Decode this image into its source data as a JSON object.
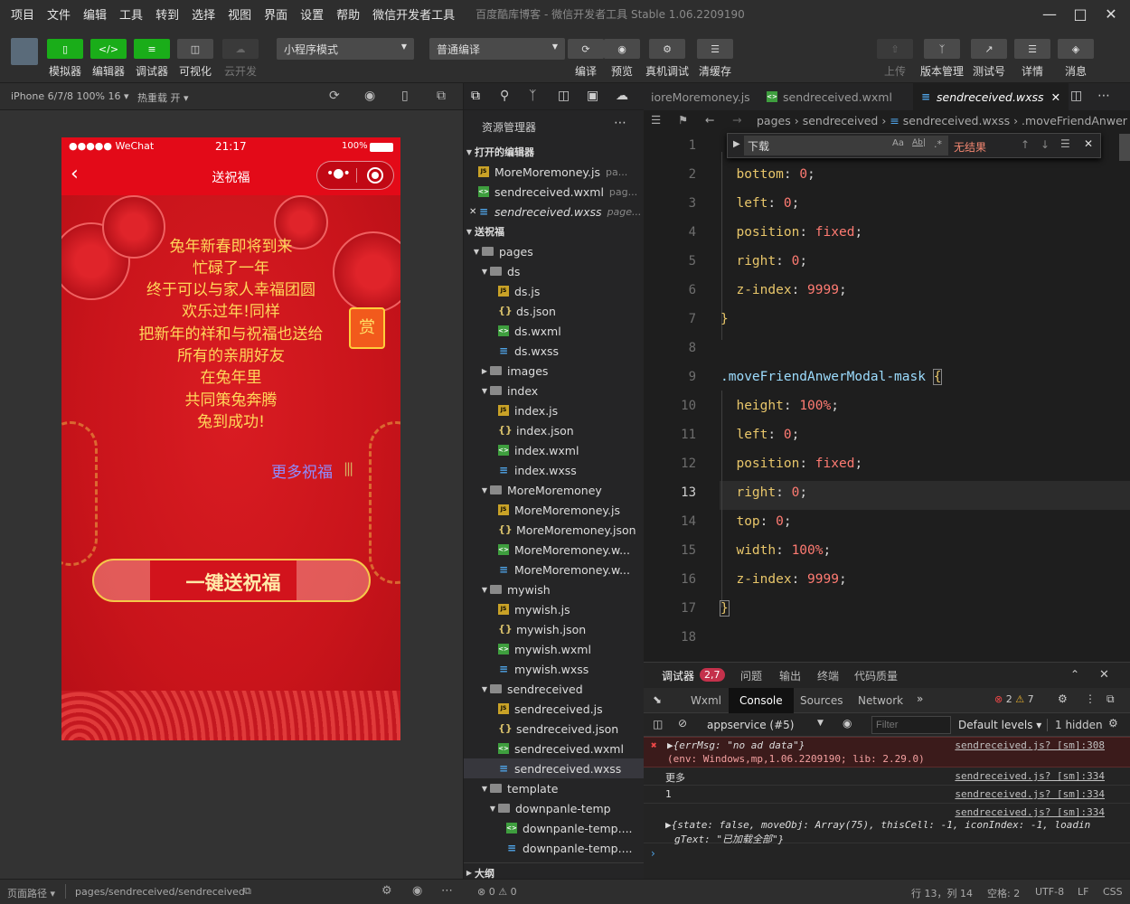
{
  "menu": {
    "items": [
      "项目",
      "文件",
      "编辑",
      "工具",
      "转到",
      "选择",
      "视图",
      "界面",
      "设置",
      "帮助",
      "微信开发者工具"
    ],
    "title": "百度酷库博客 - 微信开发者工具 Stable 1.06.2209190"
  },
  "toolbar": {
    "simulator": "模拟器",
    "editor": "编辑器",
    "debugger": "调试器",
    "visual": "可视化",
    "cloud": "云开发",
    "mode": "小程序模式",
    "compile_mode": "普通编译",
    "compile": "编译",
    "preview": "预览",
    "remote_debug": "真机调试",
    "clear_cache": "清缓存",
    "upload": "上传",
    "version": "版本管理",
    "test": "测试号",
    "details": "详情",
    "message": "消息"
  },
  "sim": {
    "device": "iPhone 6/7/8 100% 16",
    "hot_reload": "热重载 开"
  },
  "phone": {
    "carrier": "●●●●● WeChat",
    "time": "21:17",
    "battery": "100%",
    "title": "送祝福",
    "lines": [
      "兔年新春即将到来",
      "忙碌了一年",
      "终于可以与家人幸福团圆",
      "欢乐过年!同样",
      "把新年的祥和与祝福也送给",
      "所有的亲朋好友",
      "在兔年里",
      "共同策兔奔腾",
      "兔到成功!"
    ],
    "more": "更多祝福",
    "send_button": "一键送祝福",
    "gift_badge": "赏"
  },
  "explorer": {
    "title": "资源管理器",
    "open_editors": "打开的编辑器",
    "project": "送祝福",
    "outline": "大纲",
    "open_files": [
      {
        "name": "MoreMoremoney.js",
        "path": "pa...",
        "type": "js"
      },
      {
        "name": "sendreceived.wxml",
        "path": "pag...",
        "type": "wxml"
      },
      {
        "name": "sendreceived.wxss",
        "path": "page...",
        "type": "wxss"
      }
    ],
    "tree": [
      {
        "name": "pages",
        "type": "folder",
        "depth": 1
      },
      {
        "name": "ds",
        "type": "folder",
        "depth": 2
      },
      {
        "name": "ds.js",
        "type": "js",
        "depth": 3
      },
      {
        "name": "ds.json",
        "type": "json",
        "depth": 3
      },
      {
        "name": "ds.wxml",
        "type": "wxml",
        "depth": 3
      },
      {
        "name": "ds.wxss",
        "type": "wxss",
        "depth": 3
      },
      {
        "name": "images",
        "type": "folder-closed",
        "depth": 2
      },
      {
        "name": "index",
        "type": "folder",
        "depth": 2
      },
      {
        "name": "index.js",
        "type": "js",
        "depth": 3
      },
      {
        "name": "index.json",
        "type": "json",
        "depth": 3
      },
      {
        "name": "index.wxml",
        "type": "wxml",
        "depth": 3
      },
      {
        "name": "index.wxss",
        "type": "wxss",
        "depth": 3
      },
      {
        "name": "MoreMoremoney",
        "type": "folder",
        "depth": 2
      },
      {
        "name": "MoreMoremoney.js",
        "type": "js",
        "depth": 3
      },
      {
        "name": "MoreMoremoney.json",
        "type": "json",
        "depth": 3
      },
      {
        "name": "MoreMoremoney.w...",
        "type": "wxml",
        "depth": 3
      },
      {
        "name": "MoreMoremoney.w...",
        "type": "wxss",
        "depth": 3
      },
      {
        "name": "mywish",
        "type": "folder",
        "depth": 2
      },
      {
        "name": "mywish.js",
        "type": "js",
        "depth": 3
      },
      {
        "name": "mywish.json",
        "type": "json",
        "depth": 3
      },
      {
        "name": "mywish.wxml",
        "type": "wxml",
        "depth": 3
      },
      {
        "name": "mywish.wxss",
        "type": "wxss",
        "depth": 3
      },
      {
        "name": "sendreceived",
        "type": "folder",
        "depth": 2
      },
      {
        "name": "sendreceived.js",
        "type": "js",
        "depth": 3
      },
      {
        "name": "sendreceived.json",
        "type": "json",
        "depth": 3
      },
      {
        "name": "sendreceived.wxml",
        "type": "wxml",
        "depth": 3
      },
      {
        "name": "sendreceived.wxss",
        "type": "wxss",
        "depth": 3,
        "selected": true
      },
      {
        "name": "template",
        "type": "folder",
        "depth": 2
      },
      {
        "name": "downpanle-temp",
        "type": "folder",
        "depth": 3
      },
      {
        "name": "downpanle-temp....",
        "type": "wxml",
        "depth": 4
      },
      {
        "name": "downpanle-temp....",
        "type": "wxss",
        "depth": 4
      }
    ]
  },
  "editor": {
    "tabs": [
      "ioreMoremoney.js",
      "sendreceived.wxml",
      "sendreceived.wxss"
    ],
    "breadcrumb": [
      "pages",
      "sendreceived",
      "sendreceived.wxss",
      ".moveFriendAnwer"
    ],
    "find_text": "下载",
    "find_result": "无结果",
    "cursor_line": 13,
    "lines": [
      {
        "n": "1",
        "parts": []
      },
      {
        "n": "2",
        "parts": [
          {
            "t": "  bottom",
            "c": "prop"
          },
          {
            "t": ": ",
            "c": "plain"
          },
          {
            "t": "0",
            "c": "val"
          },
          {
            "t": ";",
            "c": "plain"
          }
        ]
      },
      {
        "n": "3",
        "parts": [
          {
            "t": "  left",
            "c": "prop"
          },
          {
            "t": ": ",
            "c": "plain"
          },
          {
            "t": "0",
            "c": "val"
          },
          {
            "t": ";",
            "c": "plain"
          }
        ]
      },
      {
        "n": "4",
        "parts": [
          {
            "t": "  position",
            "c": "prop"
          },
          {
            "t": ": ",
            "c": "plain"
          },
          {
            "t": "fixed",
            "c": "val"
          },
          {
            "t": ";",
            "c": "plain"
          }
        ]
      },
      {
        "n": "5",
        "parts": [
          {
            "t": "  right",
            "c": "prop"
          },
          {
            "t": ": ",
            "c": "plain"
          },
          {
            "t": "0",
            "c": "val"
          },
          {
            "t": ";",
            "c": "plain"
          }
        ]
      },
      {
        "n": "6",
        "parts": [
          {
            "t": "  z-index",
            "c": "prop"
          },
          {
            "t": ": ",
            "c": "plain"
          },
          {
            "t": "9999",
            "c": "val"
          },
          {
            "t": ";",
            "c": "plain"
          }
        ]
      },
      {
        "n": "7",
        "parts": [
          {
            "t": "}",
            "c": "brace"
          }
        ]
      },
      {
        "n": "8",
        "parts": []
      },
      {
        "n": "9",
        "parts": [
          {
            "t": ".moveFriendAnwerModal-mask ",
            "c": "sel-txt"
          },
          {
            "t": "{",
            "c": "brace"
          }
        ]
      },
      {
        "n": "10",
        "parts": [
          {
            "t": "  height",
            "c": "prop"
          },
          {
            "t": ": ",
            "c": "plain"
          },
          {
            "t": "100%",
            "c": "val"
          },
          {
            "t": ";",
            "c": "plain"
          }
        ]
      },
      {
        "n": "11",
        "parts": [
          {
            "t": "  left",
            "c": "prop"
          },
          {
            "t": ": ",
            "c": "plain"
          },
          {
            "t": "0",
            "c": "val"
          },
          {
            "t": ";",
            "c": "plain"
          }
        ]
      },
      {
        "n": "12",
        "parts": [
          {
            "t": "  position",
            "c": "prop"
          },
          {
            "t": ": ",
            "c": "plain"
          },
          {
            "t": "fixed",
            "c": "val"
          },
          {
            "t": ";",
            "c": "plain"
          }
        ]
      },
      {
        "n": "13",
        "parts": [
          {
            "t": "  right",
            "c": "prop"
          },
          {
            "t": ": ",
            "c": "plain"
          },
          {
            "t": "0",
            "c": "val"
          },
          {
            "t": ";",
            "c": "plain"
          }
        ]
      },
      {
        "n": "14",
        "parts": [
          {
            "t": "  top",
            "c": "prop"
          },
          {
            "t": ": ",
            "c": "plain"
          },
          {
            "t": "0",
            "c": "val"
          },
          {
            "t": ";",
            "c": "plain"
          }
        ]
      },
      {
        "n": "15",
        "parts": [
          {
            "t": "  width",
            "c": "prop"
          },
          {
            "t": ": ",
            "c": "plain"
          },
          {
            "t": "100%",
            "c": "val"
          },
          {
            "t": ";",
            "c": "plain"
          }
        ]
      },
      {
        "n": "16",
        "parts": [
          {
            "t": "  z-index",
            "c": "prop"
          },
          {
            "t": ": ",
            "c": "plain"
          },
          {
            "t": "9999",
            "c": "val"
          },
          {
            "t": ";",
            "c": "plain"
          }
        ]
      },
      {
        "n": "17",
        "parts": [
          {
            "t": "}",
            "c": "brace"
          }
        ]
      },
      {
        "n": "18",
        "parts": []
      }
    ]
  },
  "console": {
    "tabs": [
      "调试器",
      "问题",
      "输出",
      "终端",
      "代码质量"
    ],
    "badge": "2,7",
    "devtabs": [
      "Wxml",
      "Console",
      "Sources",
      "Network"
    ],
    "errors": "2",
    "warnings": "7",
    "context": "appservice (#5)",
    "filter_placeholder": "Filter",
    "levels": "Default levels",
    "hidden": "1 hidden",
    "line1": "▶{errMsg: \"no ad data\"}",
    "line1b": "(env: Windows,mp,1.06.2209190; lib: 2.29.0)",
    "link1": "sendreceived.js? [sm]:308",
    "line2": "更多",
    "link2": "sendreceived.js? [sm]:334",
    "line3": "1",
    "link3": "sendreceived.js? [sm]:334",
    "line4": "▶{state: false, moveObj: Array(75), thisCell: -1, iconIndex: -1, loadin",
    "line4b": "gText: \"已加载全部\"}",
    "link4": "sendreceived.js? [sm]:334"
  },
  "status": {
    "page_path_label": "页面路径",
    "page_path": "pages/sendreceived/sendreceived",
    "errors": "0",
    "warnings": "0",
    "position": "行 13，列 14",
    "spaces": "空格: 2",
    "encoding": "UTF-8",
    "eol": "LF",
    "language": "CSS"
  },
  "colors": {
    "accent_green": "#1aad19",
    "wechat_red": "#e30a18",
    "wish_gold": "#ffd75a"
  }
}
